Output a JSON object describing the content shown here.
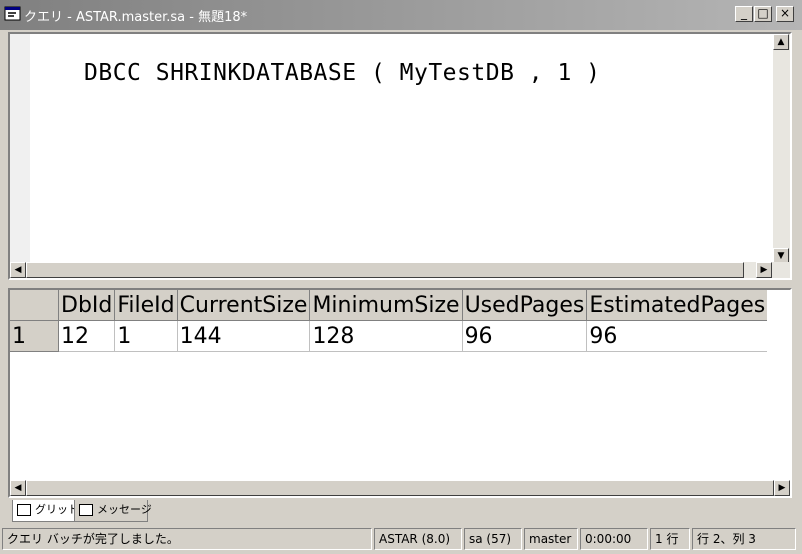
{
  "window": {
    "title": "クエリ - ASTAR.master.sa - 無題18*",
    "minimize": "_",
    "maximize": "□",
    "close": "×"
  },
  "editor": {
    "query": "DBCC SHRINKDATABASE ( MyTestDB , 1 )"
  },
  "results": {
    "columns": [
      "DbId",
      "FileId",
      "CurrentSize",
      "MinimumSize",
      "UsedPages",
      "EstimatedPages"
    ],
    "rows": [
      {
        "row_number": "1",
        "cells": [
          "12",
          "1",
          "144",
          "128",
          "96",
          "96"
        ]
      }
    ]
  },
  "tabs": [
    {
      "label": "グリッド",
      "icon": "grid-icon",
      "active": true
    },
    {
      "label": "メッセージ",
      "icon": "messages-icon",
      "active": false
    }
  ],
  "status_bar": {
    "message": "クエリ バッチが完了しました。",
    "server": "ASTAR (8.0)",
    "user": "sa (57)",
    "database": "master",
    "elapsed": "0:00:00",
    "rows": "1 行",
    "position": "行 2、列 3"
  }
}
